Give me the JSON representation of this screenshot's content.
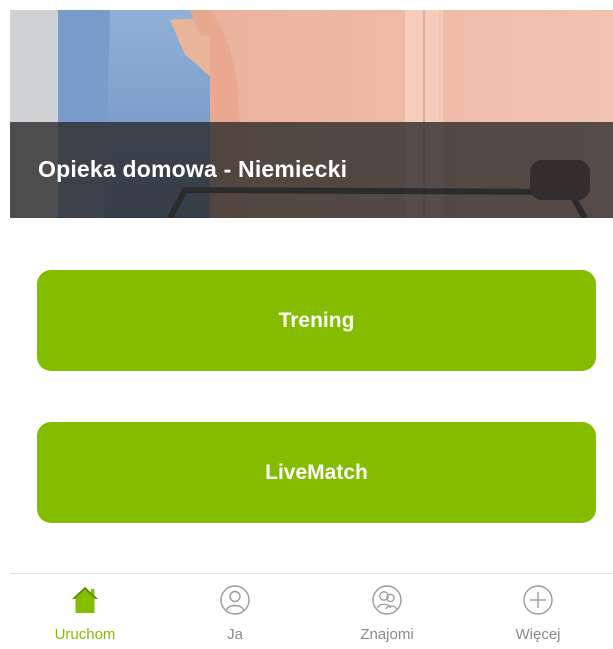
{
  "hero": {
    "title": "Opieka domowa - Niemiecki",
    "image_description_icon": "caregiver-photo"
  },
  "actions": {
    "training_label": "Trening",
    "livematch_label": "LiveMatch"
  },
  "bottom_nav": {
    "items": [
      {
        "id": "start",
        "label": "Uruchom",
        "icon": "home-icon",
        "active": true
      },
      {
        "id": "me",
        "label": "Ja",
        "icon": "person-icon",
        "active": false
      },
      {
        "id": "friends",
        "label": "Znajomi",
        "icon": "friends-icon",
        "active": false
      },
      {
        "id": "more",
        "label": "Więcej",
        "icon": "plus-circle-icon",
        "active": false
      }
    ]
  },
  "colors": {
    "accent": "#84bd00",
    "inactive": "#8a8a8a",
    "hero_band": "#282828",
    "background": "#ffffff"
  }
}
